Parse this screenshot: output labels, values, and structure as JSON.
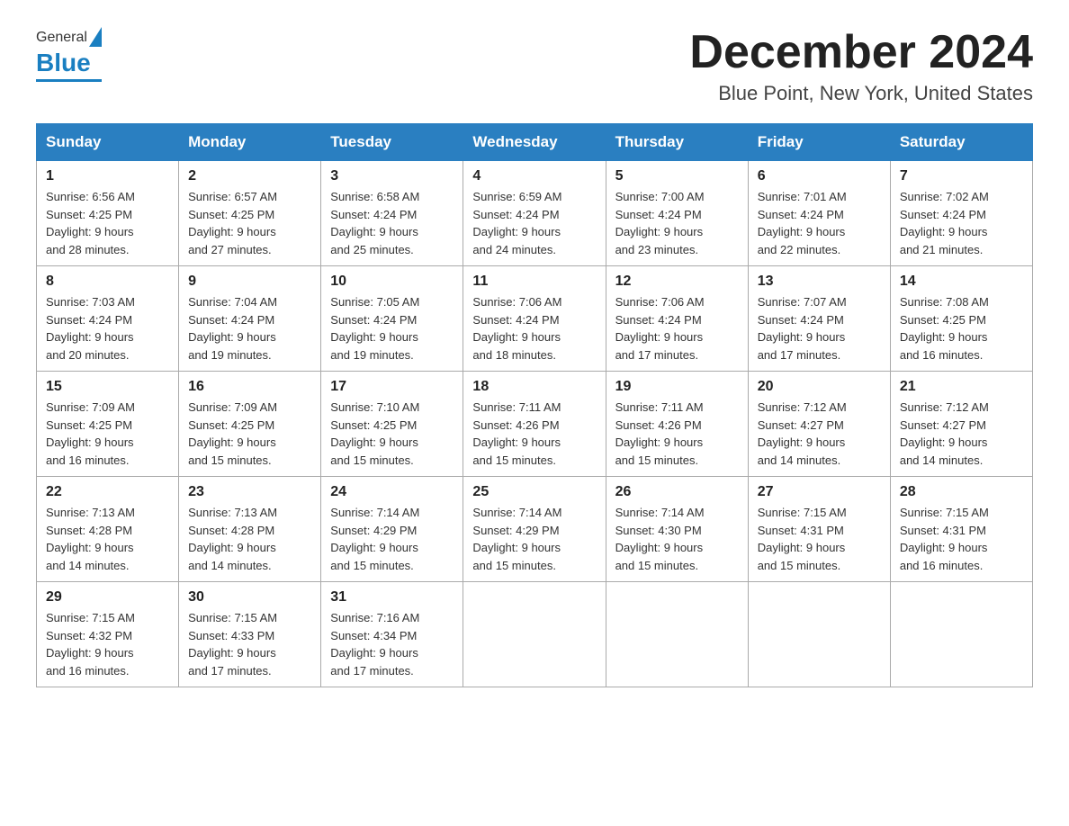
{
  "header": {
    "logo_general": "General",
    "logo_blue": "Blue",
    "month_title": "December 2024",
    "location": "Blue Point, New York, United States"
  },
  "days_of_week": [
    "Sunday",
    "Monday",
    "Tuesday",
    "Wednesday",
    "Thursday",
    "Friday",
    "Saturday"
  ],
  "weeks": [
    [
      {
        "num": "1",
        "sunrise": "6:56 AM",
        "sunset": "4:25 PM",
        "daylight": "9 hours and 28 minutes."
      },
      {
        "num": "2",
        "sunrise": "6:57 AM",
        "sunset": "4:25 PM",
        "daylight": "9 hours and 27 minutes."
      },
      {
        "num": "3",
        "sunrise": "6:58 AM",
        "sunset": "4:24 PM",
        "daylight": "9 hours and 25 minutes."
      },
      {
        "num": "4",
        "sunrise": "6:59 AM",
        "sunset": "4:24 PM",
        "daylight": "9 hours and 24 minutes."
      },
      {
        "num": "5",
        "sunrise": "7:00 AM",
        "sunset": "4:24 PM",
        "daylight": "9 hours and 23 minutes."
      },
      {
        "num": "6",
        "sunrise": "7:01 AM",
        "sunset": "4:24 PM",
        "daylight": "9 hours and 22 minutes."
      },
      {
        "num": "7",
        "sunrise": "7:02 AM",
        "sunset": "4:24 PM",
        "daylight": "9 hours and 21 minutes."
      }
    ],
    [
      {
        "num": "8",
        "sunrise": "7:03 AM",
        "sunset": "4:24 PM",
        "daylight": "9 hours and 20 minutes."
      },
      {
        "num": "9",
        "sunrise": "7:04 AM",
        "sunset": "4:24 PM",
        "daylight": "9 hours and 19 minutes."
      },
      {
        "num": "10",
        "sunrise": "7:05 AM",
        "sunset": "4:24 PM",
        "daylight": "9 hours and 19 minutes."
      },
      {
        "num": "11",
        "sunrise": "7:06 AM",
        "sunset": "4:24 PM",
        "daylight": "9 hours and 18 minutes."
      },
      {
        "num": "12",
        "sunrise": "7:06 AM",
        "sunset": "4:24 PM",
        "daylight": "9 hours and 17 minutes."
      },
      {
        "num": "13",
        "sunrise": "7:07 AM",
        "sunset": "4:24 PM",
        "daylight": "9 hours and 17 minutes."
      },
      {
        "num": "14",
        "sunrise": "7:08 AM",
        "sunset": "4:25 PM",
        "daylight": "9 hours and 16 minutes."
      }
    ],
    [
      {
        "num": "15",
        "sunrise": "7:09 AM",
        "sunset": "4:25 PM",
        "daylight": "9 hours and 16 minutes."
      },
      {
        "num": "16",
        "sunrise": "7:09 AM",
        "sunset": "4:25 PM",
        "daylight": "9 hours and 15 minutes."
      },
      {
        "num": "17",
        "sunrise": "7:10 AM",
        "sunset": "4:25 PM",
        "daylight": "9 hours and 15 minutes."
      },
      {
        "num": "18",
        "sunrise": "7:11 AM",
        "sunset": "4:26 PM",
        "daylight": "9 hours and 15 minutes."
      },
      {
        "num": "19",
        "sunrise": "7:11 AM",
        "sunset": "4:26 PM",
        "daylight": "9 hours and 15 minutes."
      },
      {
        "num": "20",
        "sunrise": "7:12 AM",
        "sunset": "4:27 PM",
        "daylight": "9 hours and 14 minutes."
      },
      {
        "num": "21",
        "sunrise": "7:12 AM",
        "sunset": "4:27 PM",
        "daylight": "9 hours and 14 minutes."
      }
    ],
    [
      {
        "num": "22",
        "sunrise": "7:13 AM",
        "sunset": "4:28 PM",
        "daylight": "9 hours and 14 minutes."
      },
      {
        "num": "23",
        "sunrise": "7:13 AM",
        "sunset": "4:28 PM",
        "daylight": "9 hours and 14 minutes."
      },
      {
        "num": "24",
        "sunrise": "7:14 AM",
        "sunset": "4:29 PM",
        "daylight": "9 hours and 15 minutes."
      },
      {
        "num": "25",
        "sunrise": "7:14 AM",
        "sunset": "4:29 PM",
        "daylight": "9 hours and 15 minutes."
      },
      {
        "num": "26",
        "sunrise": "7:14 AM",
        "sunset": "4:30 PM",
        "daylight": "9 hours and 15 minutes."
      },
      {
        "num": "27",
        "sunrise": "7:15 AM",
        "sunset": "4:31 PM",
        "daylight": "9 hours and 15 minutes."
      },
      {
        "num": "28",
        "sunrise": "7:15 AM",
        "sunset": "4:31 PM",
        "daylight": "9 hours and 16 minutes."
      }
    ],
    [
      {
        "num": "29",
        "sunrise": "7:15 AM",
        "sunset": "4:32 PM",
        "daylight": "9 hours and 16 minutes."
      },
      {
        "num": "30",
        "sunrise": "7:15 AM",
        "sunset": "4:33 PM",
        "daylight": "9 hours and 17 minutes."
      },
      {
        "num": "31",
        "sunrise": "7:16 AM",
        "sunset": "4:34 PM",
        "daylight": "9 hours and 17 minutes."
      },
      null,
      null,
      null,
      null
    ]
  ],
  "labels": {
    "sunrise": "Sunrise: ",
    "sunset": "Sunset: ",
    "daylight": "Daylight: "
  }
}
